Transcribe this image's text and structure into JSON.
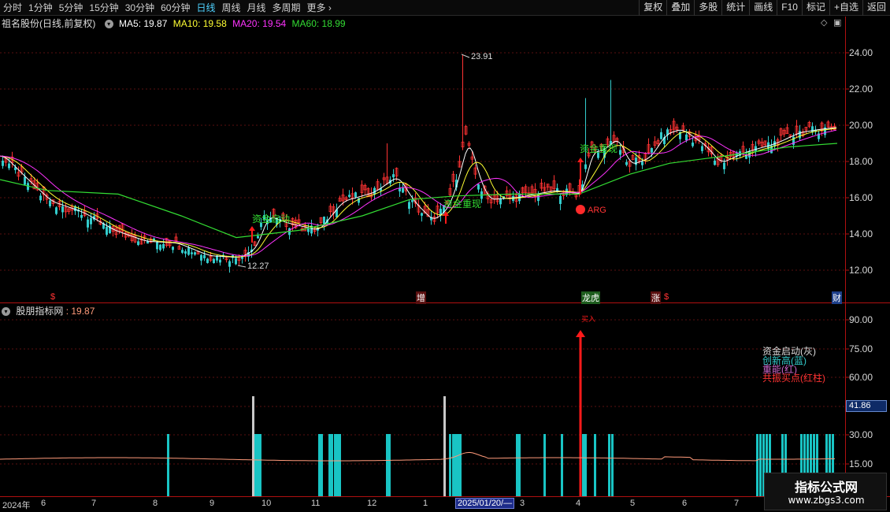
{
  "toolbar": {
    "tabs": [
      "分时",
      "1分钟",
      "5分钟",
      "15分钟",
      "30分钟",
      "60分钟",
      "日线",
      "周线",
      "月线",
      "多周期",
      "更多"
    ],
    "active_tab": "日线",
    "more_arrow": "›",
    "right_buttons": [
      "复权",
      "叠加",
      "多股",
      "统计",
      "画线",
      "F10",
      "标记",
      "+自选",
      "返回"
    ]
  },
  "main": {
    "title": "祖名股份(日线,前复权)",
    "ma": [
      {
        "label": "MA5: 19.87",
        "color": "#ffffff"
      },
      {
        "label": "MA10: 19.58",
        "color": "#ffff33"
      },
      {
        "label": "MA20: 19.54",
        "color": "#ff33ff"
      },
      {
        "label": "MA60: 18.99",
        "color": "#33dd33"
      }
    ],
    "y_ticks": [
      "24.00",
      "22.00",
      "20.00",
      "18.00",
      "16.00",
      "14.00",
      "12.00"
    ],
    "high_label": "23.91",
    "low_label": "12.27",
    "signals": [
      {
        "text": "资金启动",
        "color": "#33dd33"
      },
      {
        "text": "资金重现",
        "color": "#33dd33"
      },
      {
        "text": "资金重现",
        "color": "#33dd33"
      }
    ],
    "arg_label": "ARG",
    "markers": [
      "$",
      "增",
      "龙虎",
      "涨",
      "$",
      "财"
    ],
    "corner_icons": [
      "◇",
      "▣"
    ]
  },
  "sub": {
    "title": "股朋指标网",
    "value": ": 19.87",
    "y_ticks": [
      "90.00",
      "75.00",
      "60.00",
      "30.00",
      "15.00"
    ],
    "current_value": "41.86",
    "legend": [
      {
        "text": "资金启动(灰)",
        "color": "#c8c8c8"
      },
      {
        "text": "创新高(蓝)",
        "color": "#33cccc"
      },
      {
        "text": "重能(红)",
        "color": "#cc66cc"
      },
      {
        "text": "共振买点(红柱)",
        "color": "#ff3333"
      }
    ],
    "spike_label": "买入",
    "colors": {
      "cyan": "#19c4c4",
      "gray": "#c8c8c8",
      "red": "#ff1a1a",
      "line": "#ff9a7a"
    }
  },
  "dates": {
    "labels": [
      "2024年",
      "6",
      "7",
      "8",
      "9",
      "10",
      "11",
      "12",
      "1",
      "3",
      "4",
      "5",
      "6",
      "7"
    ],
    "cursor": "2025/01/20/—"
  },
  "watermark": {
    "title": "指标公式网",
    "url": "www.zbgs3.com"
  }
}
